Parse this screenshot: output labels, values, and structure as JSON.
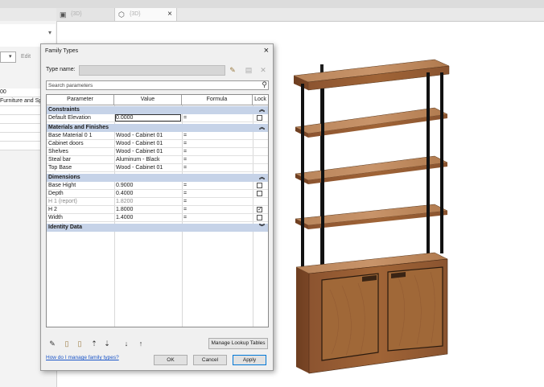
{
  "tabs": [
    {
      "label": "{3D}",
      "icon": "floor-plan-icon"
    },
    {
      "label": "{3D}",
      "icon": "3d-view-icon",
      "close": "×"
    }
  ],
  "left_panel": {
    "edit_label": "Edit",
    "rows": [
      "00",
      "Furniture and Spe"
    ]
  },
  "dialog": {
    "title": "Family Types",
    "close": "×",
    "type_name_label": "Type name:",
    "search_placeholder": "Search parameters",
    "columns": [
      "Parameter",
      "Value",
      "Formula",
      "Lock"
    ],
    "groups": [
      {
        "name": "Constraints",
        "rows": [
          {
            "param": "Default Elevation",
            "value": "0.0000",
            "formula": "=",
            "lock": "unchecked",
            "editing": true
          }
        ]
      },
      {
        "name": "Materials and Finishes",
        "rows": [
          {
            "param": "Base Material 0 1",
            "value": "Wood - Cabinet 01",
            "formula": "=",
            "lock": ""
          },
          {
            "param": "Cabinet doors",
            "value": "Wood - Cabinet 01",
            "formula": "=",
            "lock": ""
          },
          {
            "param": "Shelves",
            "value": "Wood - Cabinet 01",
            "formula": "=",
            "lock": ""
          },
          {
            "param": "Steal bar",
            "value": "Aluminum - Black",
            "formula": "=",
            "lock": ""
          },
          {
            "param": "Top Base",
            "value": "Wood - Cabinet 01",
            "formula": "=",
            "lock": ""
          }
        ]
      },
      {
        "name": "Dimensions",
        "rows": [
          {
            "param": "Base Hight",
            "value": "0.9000",
            "formula": "=",
            "lock": "unchecked"
          },
          {
            "param": "Depth",
            "value": "0.4000",
            "formula": "=",
            "lock": "unchecked"
          },
          {
            "param": "H 1 (report)",
            "value": "1.8200",
            "formula": "=",
            "lock": "",
            "dim": true
          },
          {
            "param": "H 2",
            "value": "1.8000",
            "formula": "=",
            "lock": "checked"
          },
          {
            "param": "Width",
            "value": "1.4000",
            "formula": "=",
            "lock": "unchecked"
          }
        ]
      },
      {
        "name": "Identity Data",
        "rows": []
      }
    ],
    "manage_lookup_label": "Manage Lookup Tables",
    "help_link": "How do I manage family types?",
    "ok_label": "OK",
    "cancel_label": "Cancel",
    "apply_label": "Apply"
  },
  "colors": {
    "group_header": "#c6d3e8",
    "wood": "#a86a3c",
    "steel": "#2b2b2b",
    "link": "#1a55c8"
  }
}
